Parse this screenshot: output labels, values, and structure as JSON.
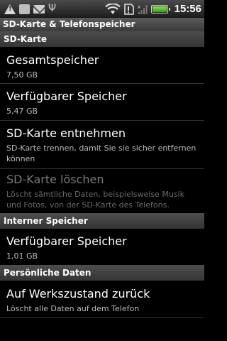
{
  "status_bar": {
    "time": "15:56",
    "battery_level": 1.0,
    "icons": [
      "warning-icon",
      "box-icon",
      "mail-icon",
      "usb-icon",
      "wifi-icon",
      "sim-icon",
      "signal-icon",
      "battery-icon"
    ]
  },
  "title": "SD-Karte & Telefonspeicher",
  "sections": {
    "sd": "SD-Karte",
    "internal": "Interner Speicher",
    "personal": "Persönliche Daten"
  },
  "items": {
    "total": {
      "title": "Gesamtspeicher",
      "summary": "7,50 GB"
    },
    "available_sd": {
      "title": "Verfügbarer Speicher",
      "summary": "5,47 GB"
    },
    "unmount": {
      "title": "SD-Karte entnehmen",
      "summary": "SD-Karte trennen, damit Sie sie sicher entfernen können"
    },
    "format": {
      "title": "SD-Karte löschen",
      "summary": "Löscht sämtliche Daten, beispielsweise Musik und Fotos, von der SD-Karte des Telefons."
    },
    "available_internal": {
      "title": "Verfügbarer Speicher",
      "summary": "1,01 GB"
    },
    "factory_reset": {
      "title": "Auf Werkszustand zurück",
      "summary": "Löscht alle Daten auf dem Telefon"
    }
  },
  "colors": {
    "background": "#000000",
    "header": "#444444",
    "disabled_text": "#7a7a7a",
    "battery": "#5ec42e"
  }
}
